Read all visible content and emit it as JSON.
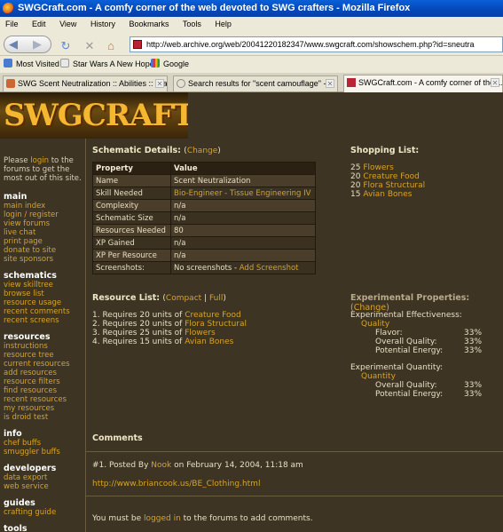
{
  "window": {
    "title": "SWGCraft.com - A comfy corner of the web devoted to SWG crafters - Mozilla Firefox"
  },
  "menu": [
    "File",
    "Edit",
    "View",
    "History",
    "Bookmarks",
    "Tools",
    "Help"
  ],
  "nav": {
    "url": "http://web.archive.org/web/20041220182347/www.swgcraft.com/showschem.php?id=sneutra"
  },
  "bookmarks": [
    "Most Visited",
    "Star Wars A New Hope",
    "Google"
  ],
  "tabs": [
    {
      "label": "SWG Scent Neutralization :: Abilities :: Star ..."
    },
    {
      "label": "Search results for \"scent camouflage\" - ..."
    },
    {
      "label": "SWGCraft.com - A comfy corner of the ..."
    }
  ],
  "site": {
    "logo": "SWGCRAFT.COM"
  },
  "sidebar": {
    "login_pre": "Please ",
    "login_link": "login",
    "login_post": " to the forums to get the most out of this site.",
    "sections": [
      {
        "title": "main",
        "links": [
          "main index",
          "login / register",
          "view forums",
          "live chat",
          "print page",
          "donate to site",
          "site sponsors"
        ]
      },
      {
        "title": "schematics",
        "links": [
          "view skilltree",
          "browse list",
          "resource usage",
          "recent comments",
          "recent screens"
        ]
      },
      {
        "title": "resources",
        "links": [
          "instructions",
          "resource tree",
          "current resources",
          "add resources",
          "resource filters",
          "find resources",
          "recent resources",
          "my resources",
          "is droid test"
        ]
      },
      {
        "title": "info",
        "links": [
          "chef buffs",
          "smuggler buffs"
        ]
      },
      {
        "title": "developers",
        "links": [
          "data export",
          "web service"
        ]
      },
      {
        "title": "guides",
        "links": [
          "crafting guide"
        ]
      },
      {
        "title": "tools",
        "links": []
      }
    ]
  },
  "schematic": {
    "heading": "Schematic Details:",
    "change": "Change",
    "col_property": "Property",
    "col_value": "Value",
    "rows": [
      {
        "property": "Name",
        "value": "Scent Neutralization"
      },
      {
        "property": "Skill Needed",
        "value": "Bio-Engineer - Tissue Engineering IV"
      },
      {
        "property": "Complexity",
        "value": "n/a"
      },
      {
        "property": "Schematic Size",
        "value": "n/a"
      },
      {
        "property": "Resources Needed",
        "value": "80"
      },
      {
        "property": "XP Gained",
        "value": "n/a"
      },
      {
        "property": "XP Per Resource",
        "value": "n/a"
      },
      {
        "property": "Screenshots:",
        "value": "No screenshots - ",
        "value_link": "Add Screenshot"
      }
    ]
  },
  "shopping": {
    "heading": "Shopping List:",
    "items": [
      {
        "qty": "25",
        "name": "Flowers"
      },
      {
        "qty": "20",
        "name": "Creature Food"
      },
      {
        "qty": "20",
        "name": "Flora Structural"
      },
      {
        "qty": "15",
        "name": "Avian Bones"
      }
    ]
  },
  "resource_list": {
    "heading": "Resource List:",
    "compact": "Compact",
    "full": "Full",
    "items": [
      {
        "pre": "1. Requires 20 units of ",
        "name": "Creature Food"
      },
      {
        "pre": "2. Requires 20 units of ",
        "name": "Flora Structural"
      },
      {
        "pre": "3. Requires 25 units of ",
        "name": "Flowers"
      },
      {
        "pre": "4. Requires 15 units of ",
        "name": "Avian Bones"
      }
    ]
  },
  "experimental": {
    "heading": "Experimental Properties:",
    "change": "Change",
    "effectiveness_title": "Experimental Effectiveness:",
    "effectiveness_group": "Quality",
    "effectiveness": [
      {
        "name": "Flavor:",
        "value": "33%"
      },
      {
        "name": "Overall Quality:",
        "value": "33%"
      },
      {
        "name": "Potential Energy:",
        "value": "33%"
      }
    ],
    "quantity_title": "Experimental Quantity:",
    "quantity_group": "Quantity",
    "quantity": [
      {
        "name": "Overall Quality:",
        "value": "33%"
      },
      {
        "name": "Potential Energy:",
        "value": "33%"
      }
    ]
  },
  "comments": {
    "heading": "Comments",
    "post_pre": "#1. Posted By ",
    "author": "Nook",
    "post_date": " on February 14, 2004, 11:18 am",
    "link": "http://www.briancook.us/BE_Clothing.html",
    "footer_pre": "You must be ",
    "footer_link": "logged in",
    "footer_post": " to the forums to add comments."
  }
}
